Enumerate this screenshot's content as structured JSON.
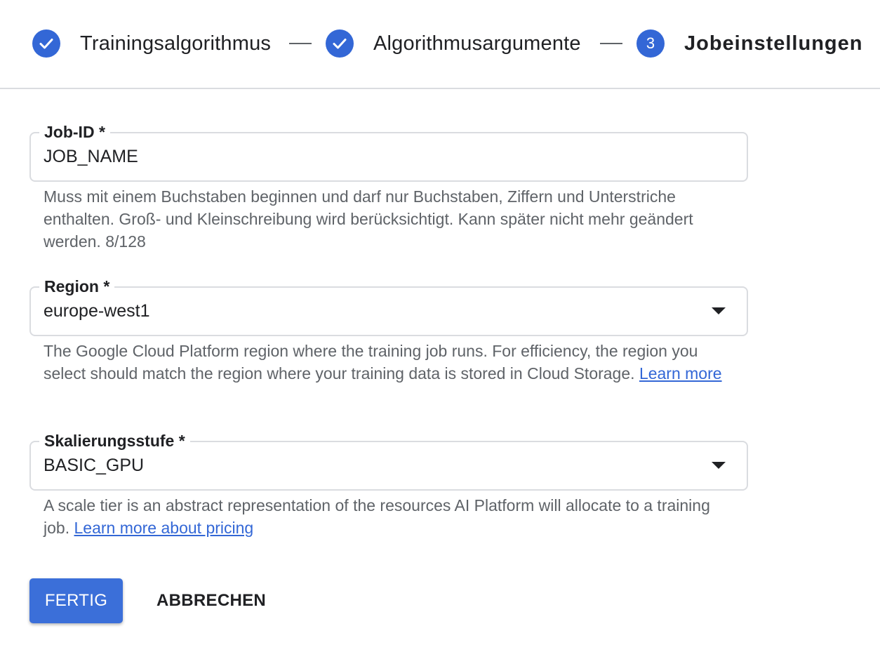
{
  "stepper": {
    "steps": [
      {
        "label": "Trainingsalgorithmus",
        "status": "done"
      },
      {
        "label": "Algorithmusargumente",
        "status": "done"
      },
      {
        "label": "Jobeinstellungen",
        "status": "active",
        "number": "3"
      }
    ]
  },
  "form": {
    "job_id": {
      "label": "Job-ID *",
      "value": "JOB_NAME",
      "helper": "Muss mit einem Buchstaben beginnen und darf nur Buchstaben, Ziffern und Unterstriche enthalten. Groß- und Kleinschreibung wird berücksichtigt. Kann später nicht mehr geändert werden. 8/128"
    },
    "region": {
      "label": "Region *",
      "value": "europe-west1",
      "helper": "The Google Cloud Platform region where the training job runs. For efficiency, the region you select should match the region where your training data is stored in Cloud Storage.",
      "link": "Learn more"
    },
    "scale_tier": {
      "label": "Skalierungsstufe *",
      "value": "BASIC_GPU",
      "helper": "A scale tier is an abstract representation of the resources AI Platform will allocate to a training job.",
      "link": "Learn more about pricing"
    }
  },
  "actions": {
    "done_label": "FERTIG",
    "cancel_label": "ABBRECHEN"
  },
  "colors": {
    "accent": "#3367d6",
    "border": "#dadce0",
    "helper_text": "#5f6368"
  }
}
